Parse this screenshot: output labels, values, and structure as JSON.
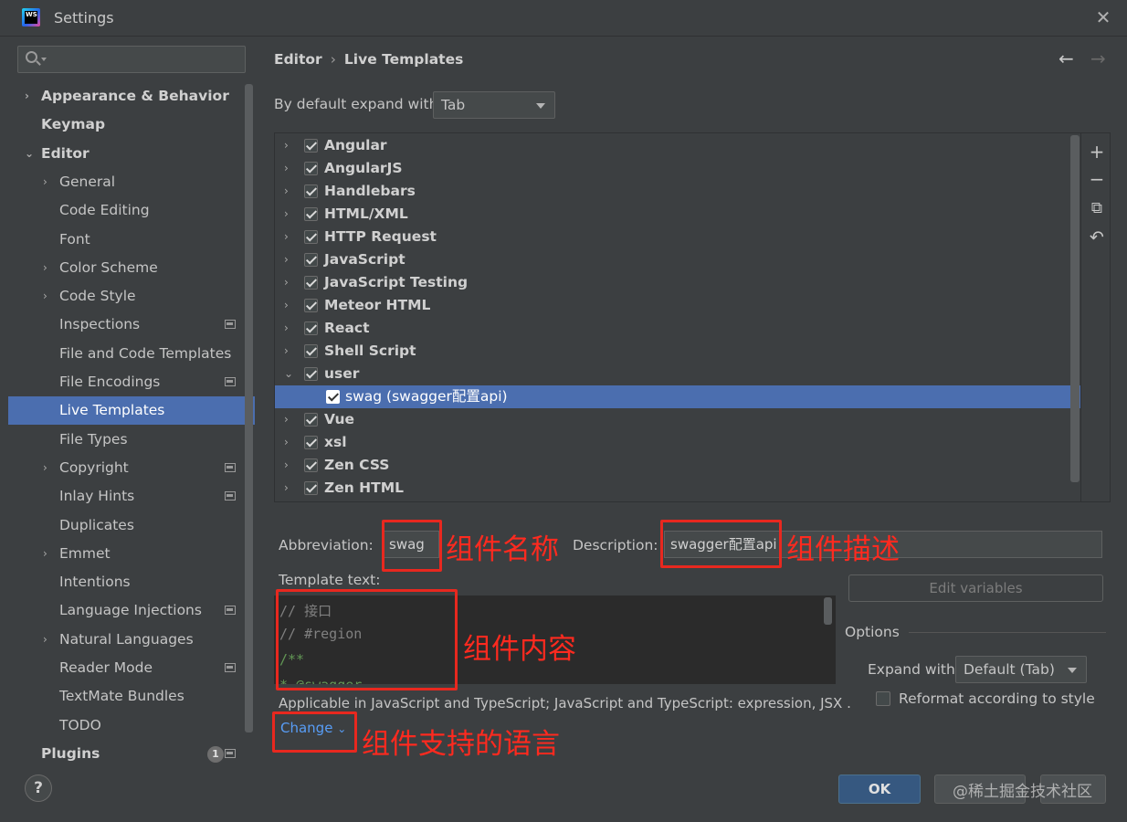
{
  "window": {
    "title": "Settings",
    "logo_text": "WS"
  },
  "sidebar": {
    "search_placeholder": "",
    "items": [
      {
        "label": "Appearance & Behavior",
        "arrow": "›",
        "bold": true
      },
      {
        "label": "Keymap",
        "bold": true
      },
      {
        "label": "Editor",
        "arrow": "⌄",
        "bold": true
      },
      {
        "label": "General",
        "arrow": "›"
      },
      {
        "label": "Code Editing"
      },
      {
        "label": "Font"
      },
      {
        "label": "Color Scheme",
        "arrow": "›"
      },
      {
        "label": "Code Style",
        "arrow": "›"
      },
      {
        "label": "Inspections",
        "page_icon": true
      },
      {
        "label": "File and Code Templates"
      },
      {
        "label": "File Encodings",
        "page_icon": true
      },
      {
        "label": "Live Templates",
        "selected": true
      },
      {
        "label": "File Types"
      },
      {
        "label": "Copyright",
        "arrow": "›",
        "page_icon": true
      },
      {
        "label": "Inlay Hints",
        "page_icon": true
      },
      {
        "label": "Duplicates"
      },
      {
        "label": "Emmet",
        "arrow": "›"
      },
      {
        "label": "Intentions"
      },
      {
        "label": "Language Injections",
        "page_icon": true
      },
      {
        "label": "Natural Languages",
        "arrow": "›"
      },
      {
        "label": "Reader Mode",
        "page_icon": true
      },
      {
        "label": "TextMate Bundles"
      },
      {
        "label": "TODO"
      },
      {
        "label": "Plugins",
        "bold": true,
        "badge": "1",
        "page_icon": true
      }
    ]
  },
  "breadcrumb": {
    "parent": "Editor",
    "separator": "›",
    "current": "Live Templates"
  },
  "nav": {
    "back": "←",
    "forward": "→"
  },
  "expand": {
    "label": "By default expand with",
    "value": "Tab"
  },
  "template_groups": [
    {
      "label": "Angular",
      "expanded": false
    },
    {
      "label": "AngularJS",
      "expanded": false
    },
    {
      "label": "Handlebars",
      "expanded": false
    },
    {
      "label": "HTML/XML",
      "expanded": false
    },
    {
      "label": "HTTP Request",
      "expanded": false
    },
    {
      "label": "JavaScript",
      "expanded": false
    },
    {
      "label": "JavaScript Testing",
      "expanded": false
    },
    {
      "label": "Meteor HTML",
      "expanded": false
    },
    {
      "label": "React",
      "expanded": false
    },
    {
      "label": "Shell Script",
      "expanded": false
    },
    {
      "label": "user",
      "expanded": true
    },
    {
      "label": "swag (swagger配置api)",
      "child": true,
      "selected": true
    },
    {
      "label": "Vue",
      "expanded": false
    },
    {
      "label": "xsl",
      "expanded": false
    },
    {
      "label": "Zen CSS",
      "expanded": false
    },
    {
      "label": "Zen HTML",
      "expanded": false
    }
  ],
  "toolbar": {
    "add": "+",
    "remove": "−",
    "copy": "⧉",
    "restore": "↶"
  },
  "form": {
    "abbreviation_label": "Abbreviation:",
    "abbreviation_value": "swag",
    "description_label": "Description:",
    "description_value": "swagger配置api",
    "template_text_label": "Template text:",
    "template_lines": [
      {
        "text": "// 接口",
        "color": "#808080"
      },
      {
        "text": "// #region",
        "color": "#808080"
      },
      {
        "text": "/**",
        "color": "#629755"
      },
      {
        "text": " * @swagger",
        "color": "#629755"
      }
    ],
    "edit_variables": "Edit variables",
    "applicable_text": "Applicable in JavaScript and TypeScript; JavaScript and TypeScript: expression, JSX .",
    "change_link": "Change",
    "change_arrow": "⌄"
  },
  "options": {
    "title": "Options",
    "expand_with_label": "Expand with",
    "expand_with_value": "Default (Tab)",
    "reformat_label": "Reformat according to style",
    "reformat_checked": false
  },
  "annotations": {
    "name": "组件名称",
    "description": "组件描述",
    "content": "组件内容",
    "language": "组件支持的语言",
    "color": "#ff2a1f"
  },
  "footer": {
    "help": "?",
    "ok": "OK",
    "watermark": "@稀土掘金技术社区"
  },
  "colors": {
    "background": "#3c3f41",
    "selection": "#4b6eaf",
    "link": "#589df6",
    "ok_button": "#365880"
  }
}
